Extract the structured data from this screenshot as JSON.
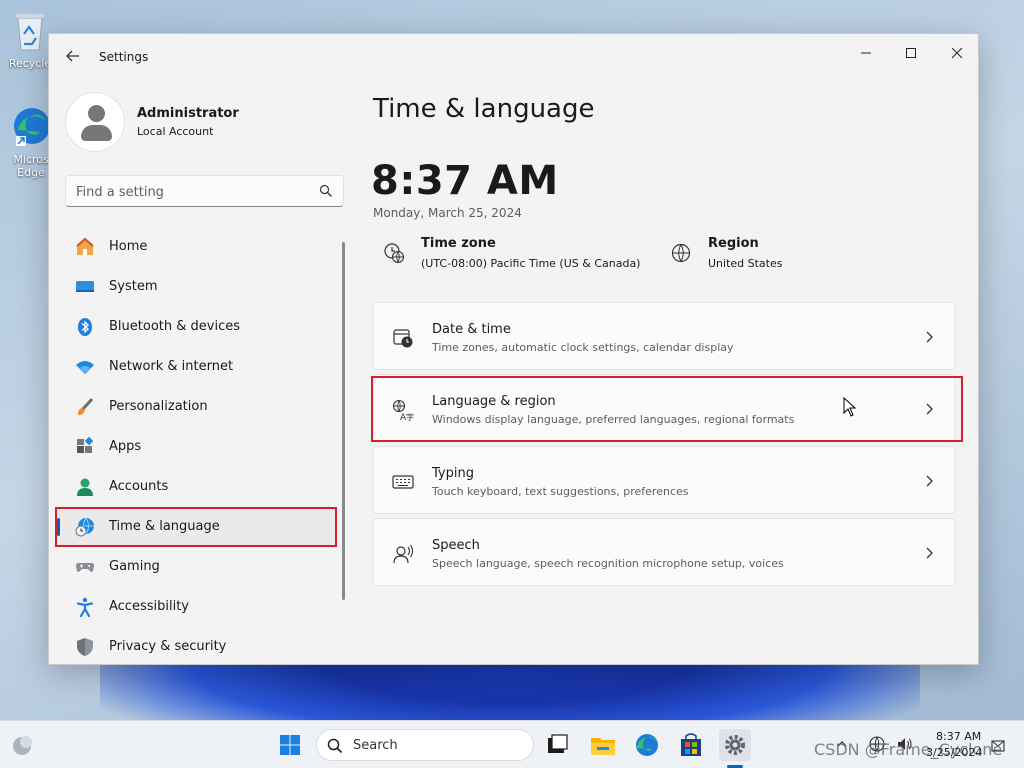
{
  "desktop": {
    "icons": [
      {
        "label": "Recycle"
      },
      {
        "label": "Micros Edge"
      }
    ]
  },
  "window": {
    "title": "Settings",
    "controls": {
      "minimize": "—",
      "maximize": "☐",
      "close": "✕"
    }
  },
  "profile": {
    "name": "Administrator",
    "account_type": "Local Account"
  },
  "search": {
    "placeholder": "Find a setting"
  },
  "sidebar": {
    "items": [
      {
        "label": "Home",
        "icon": "home-icon"
      },
      {
        "label": "System",
        "icon": "system-icon"
      },
      {
        "label": "Bluetooth & devices",
        "icon": "bluetooth-icon"
      },
      {
        "label": "Network & internet",
        "icon": "wifi-icon"
      },
      {
        "label": "Personalization",
        "icon": "brush-icon"
      },
      {
        "label": "Apps",
        "icon": "apps-icon"
      },
      {
        "label": "Accounts",
        "icon": "accounts-icon"
      },
      {
        "label": "Time & language",
        "icon": "time-language-icon",
        "selected": true
      },
      {
        "label": "Gaming",
        "icon": "gamepad-icon"
      },
      {
        "label": "Accessibility",
        "icon": "accessibility-icon"
      },
      {
        "label": "Privacy & security",
        "icon": "shield-icon"
      }
    ]
  },
  "main": {
    "title": "Time & language",
    "clock": "8:37 AM",
    "date": "Monday, March 25, 2024",
    "timezone": {
      "title": "Time zone",
      "value": "(UTC-08:00) Pacific Time (US & Canada)"
    },
    "region": {
      "title": "Region",
      "value": "United States"
    },
    "cards": [
      {
        "title": "Date & time",
        "desc": "Time zones, automatic clock settings, calendar display",
        "icon": "calendar-clock-icon"
      },
      {
        "title": "Language & region",
        "desc": "Windows display language, preferred languages, regional formats",
        "icon": "language-icon"
      },
      {
        "title": "Typing",
        "desc": "Touch keyboard, text suggestions, preferences",
        "icon": "keyboard-icon"
      },
      {
        "title": "Speech",
        "desc": "Speech language, speech recognition microphone setup, voices",
        "icon": "speech-icon"
      }
    ]
  },
  "taskbar": {
    "search_label": "Search",
    "time": "8:37 AM",
    "date": "3/25/2024",
    "watermark": "CSDN @Frame_Cyclone"
  },
  "colors": {
    "accent": "#0067c0",
    "highlight": "#d9202a"
  }
}
